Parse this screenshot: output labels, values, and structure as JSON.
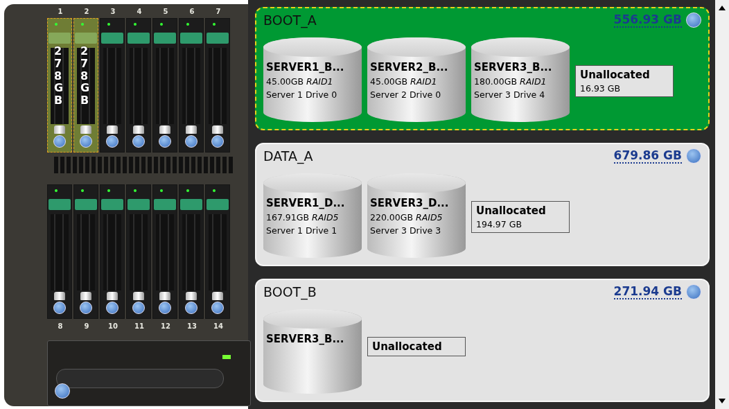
{
  "bays_top": [
    {
      "number": "1",
      "selected": true,
      "label": "278GB"
    },
    {
      "number": "2",
      "selected": true,
      "label": "278GB"
    },
    {
      "number": "3",
      "selected": false
    },
    {
      "number": "4",
      "selected": false
    },
    {
      "number": "5",
      "selected": false
    },
    {
      "number": "6",
      "selected": false
    },
    {
      "number": "7",
      "selected": false
    }
  ],
  "bays_bottom": [
    {
      "number": "8",
      "selected": false
    },
    {
      "number": "9",
      "selected": false
    },
    {
      "number": "10",
      "selected": false
    },
    {
      "number": "11",
      "selected": false
    },
    {
      "number": "12",
      "selected": false
    },
    {
      "number": "13",
      "selected": false
    },
    {
      "number": "14",
      "selected": false
    }
  ],
  "pools": [
    {
      "name": "BOOT_A",
      "size": "556.93 GB",
      "selected": true,
      "volumes": [
        {
          "name": "SERVER1_B...",
          "size": "45.00GB",
          "raid": "RAID1",
          "location": "Server 1 Drive 0"
        },
        {
          "name": "SERVER2_B...",
          "size": "45.00GB",
          "raid": "RAID1",
          "location": "Server 2 Drive 0"
        },
        {
          "name": "SERVER3_B...",
          "size": "180.00GB",
          "raid": "RAID1",
          "location": "Server 3 Drive 4"
        }
      ],
      "unallocated": {
        "label": "Unallocated",
        "size": "16.93 GB"
      }
    },
    {
      "name": "DATA_A",
      "size": "679.86 GB",
      "selected": false,
      "volumes": [
        {
          "name": "SERVER1_D...",
          "size": "167.91GB",
          "raid": "RAID5",
          "location": "Server 1 Drive 1"
        },
        {
          "name": "SERVER3_D...",
          "size": "220.00GB",
          "raid": "RAID5",
          "location": "Server 3 Drive 3"
        }
      ],
      "unallocated": {
        "label": "Unallocated",
        "size": "194.97 GB"
      }
    },
    {
      "name": "BOOT_B",
      "size": "271.94 GB",
      "selected": false,
      "volumes": [
        {
          "name": "SERVER3_B..."
        }
      ],
      "unallocated": {
        "label": "Unallocated"
      }
    }
  ]
}
